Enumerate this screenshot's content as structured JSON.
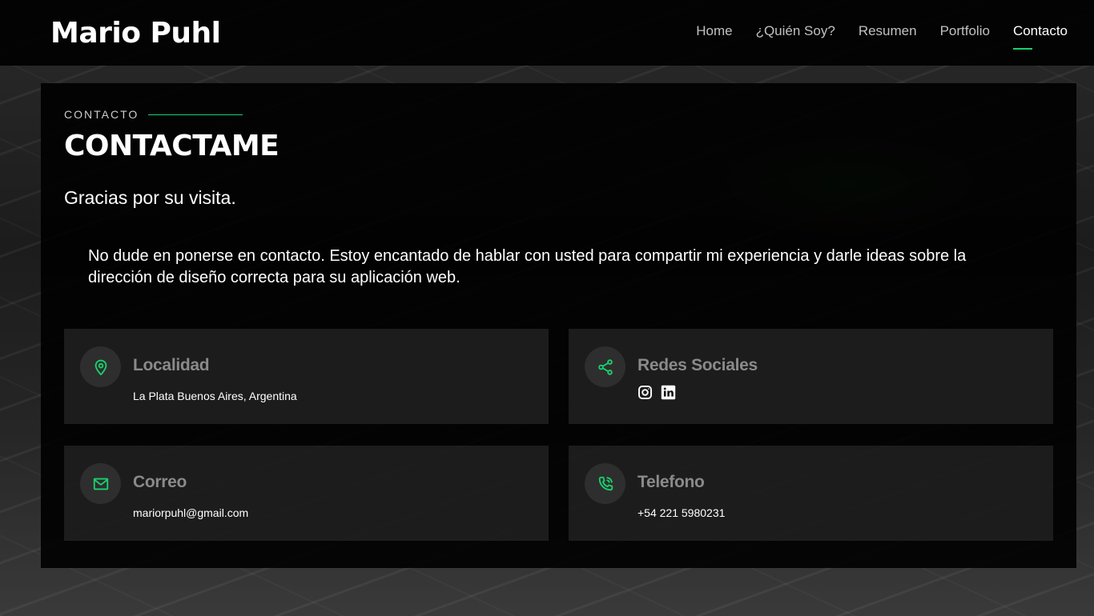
{
  "header": {
    "brand": "Mario Puhl",
    "nav": [
      {
        "label": "Home"
      },
      {
        "label": "¿Quién Soy?"
      },
      {
        "label": "Resumen"
      },
      {
        "label": "Portfolio"
      },
      {
        "label": "Contacto",
        "active": true
      }
    ]
  },
  "section": {
    "tag": "CONTACTO",
    "title": "CONTACTAME",
    "subtitle": "Gracias por su visita.",
    "intro": "No dude en ponerse en contacto. Estoy encantado de hablar con usted para compartir mi experiencia y darle ideas sobre la dirección de diseño correcta para su aplicación web."
  },
  "cards": {
    "location": {
      "title": "Localidad",
      "value": "La Plata Buenos Aires, Argentina",
      "icon": "map-pin-icon"
    },
    "social": {
      "title": "Redes Sociales",
      "icon": "share-icon",
      "links": [
        "instagram-icon",
        "linkedin-icon"
      ]
    },
    "email": {
      "title": "Correo",
      "value": "mariorpuhl@gmail.com",
      "icon": "envelope-icon"
    },
    "phone": {
      "title": "Telefono",
      "value": "+54 221 5980231",
      "icon": "phone-icon"
    }
  },
  "colors": {
    "accent": "#18d26e",
    "card_title": "#8a8a8a",
    "panel": "#000000"
  }
}
